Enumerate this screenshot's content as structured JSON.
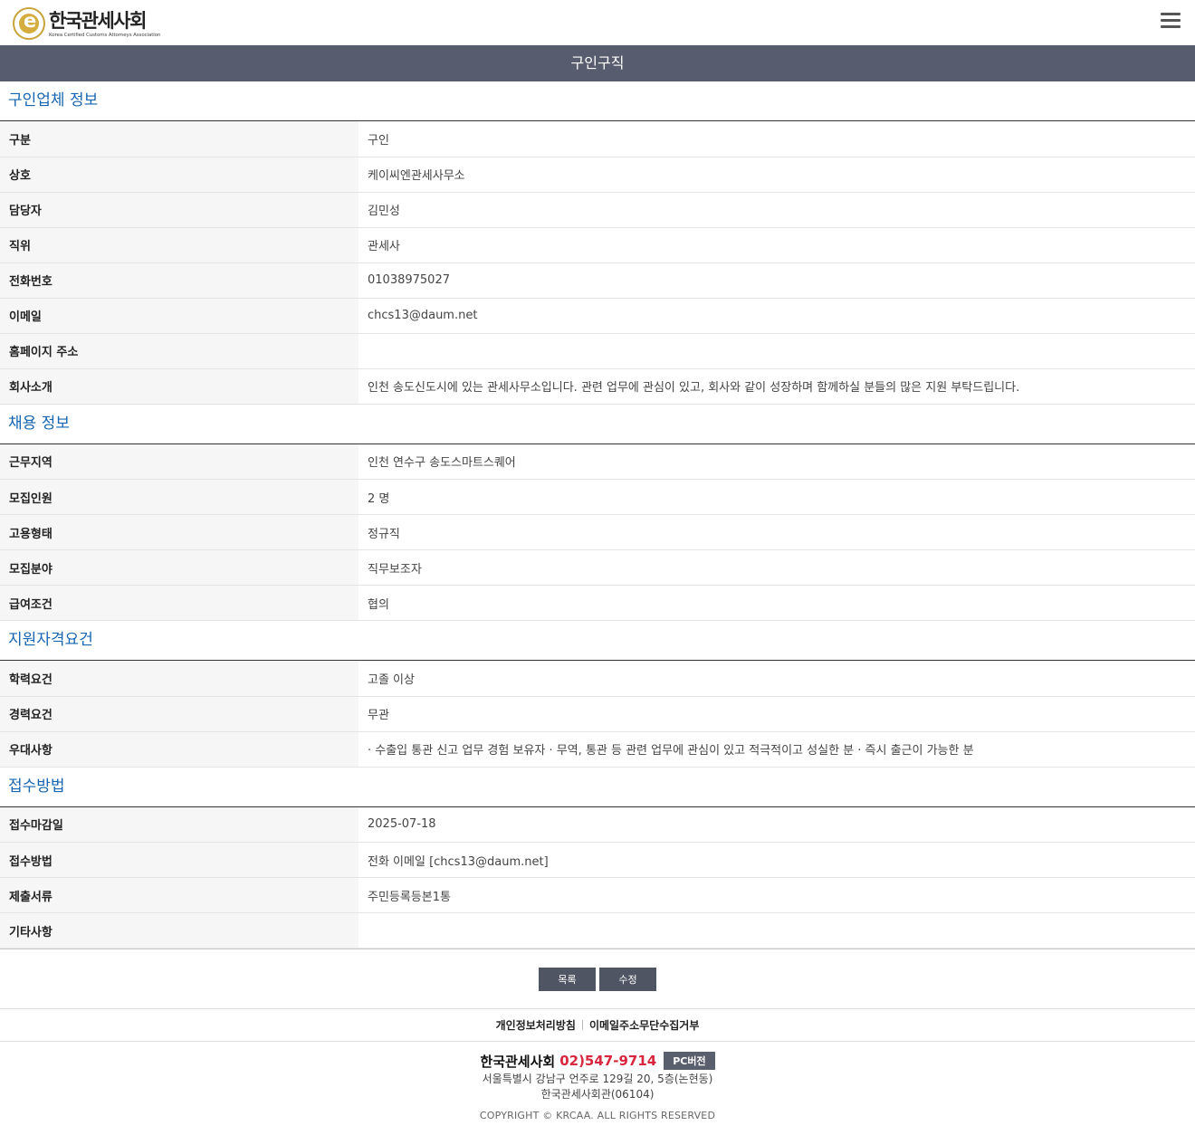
{
  "header": {
    "logo_title": "한국관세사회",
    "logo_sub": "Korea Certified Customs Attorneys Association"
  },
  "page_title": "구인구직",
  "sections": {
    "company": {
      "title": "구인업체 정보",
      "rows": [
        {
          "label": "구분",
          "value": "구인"
        },
        {
          "label": "상호",
          "value": "케이씨엔관세사무소"
        },
        {
          "label": "담당자",
          "value": "김민성"
        },
        {
          "label": "직위",
          "value": "관세사"
        },
        {
          "label": "전화번호",
          "value": "01038975027"
        },
        {
          "label": "이메일",
          "value": "chcs13@daum.net"
        },
        {
          "label": "홈페이지 주소",
          "value": ""
        },
        {
          "label": "회사소개",
          "value": "인천 송도신도시에 있는 관세사무소입니다. 관련 업무에 관심이 있고, 회사와 같이 성장하며 함께하실 분들의 많은 지원 부탁드립니다."
        }
      ]
    },
    "employment": {
      "title": "채용 정보",
      "rows": [
        {
          "label": "근무지역",
          "value": "인천 연수구 송도스마트스퀘어"
        },
        {
          "label": "모집인원",
          "value": "2 명"
        },
        {
          "label": "고용형태",
          "value": "정규직"
        },
        {
          "label": "모집분야",
          "value": "직무보조자"
        },
        {
          "label": "급여조건",
          "value": "협의"
        }
      ]
    },
    "qualification": {
      "title": "지원자격요건",
      "rows": [
        {
          "label": "학력요건",
          "value": "고졸 이상"
        },
        {
          "label": "경력요건",
          "value": "무관"
        },
        {
          "label": "우대사항",
          "value": " · 수출입 통관 신고 업무 경험 보유자  · 무역, 통관 등 관련 업무에 관심이 있고 적극적이고 성실한 분  · 즉시 출근이 가능한 분"
        }
      ]
    },
    "application": {
      "title": "접수방법",
      "rows": [
        {
          "label": "접수마감일",
          "value": "2025-07-18"
        },
        {
          "label": "접수방법",
          "value": "전화 이메일 [chcs13@daum.net]"
        },
        {
          "label": "제출서류",
          "value": "주민등록등본1통"
        },
        {
          "label": "기타사항",
          "value": ""
        }
      ]
    }
  },
  "buttons": {
    "list": "목록",
    "edit": "수정"
  },
  "footer": {
    "privacy_link": "개인정보처리방침",
    "email_link": "이메일주소무단수집거부",
    "org_name": "한국관세사회",
    "phone": "02)547-9714",
    "pc_version": "PC버전",
    "address1": "서울특별시 강남구 언주로 129길 20, 5층(논현동)",
    "address2": "한국관세사회관(06104)",
    "copyright": "COPYRIGHT © KRCAA. ALL RIGHTS RESERVED"
  },
  "colors": {
    "title_bar": "#575c6e",
    "section_title": "#1765b0",
    "phone": "#d7263d",
    "button": "#4f5563"
  }
}
